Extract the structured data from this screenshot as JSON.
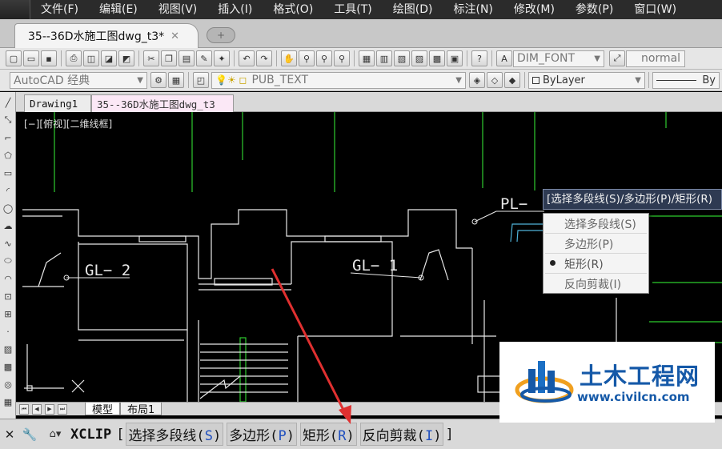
{
  "menubar": {
    "items": [
      "文件(F)",
      "编辑(E)",
      "视图(V)",
      "插入(I)",
      "格式(O)",
      "工具(T)",
      "绘图(D)",
      "标注(N)",
      "修改(M)",
      "参数(P)",
      "窗口(W)"
    ]
  },
  "tabbar": {
    "doc_tab_label": "35--36D水施工图dwg_t3*",
    "close_glyph": "✕"
  },
  "toolbar1": {
    "dim_style": "DIM_FONT",
    "text_style": "normal"
  },
  "toolbar2": {
    "workspace": "AutoCAD 经典",
    "layer": "PUB_TEXT",
    "color": "ByLayer",
    "linetype": "By"
  },
  "drawing_tabs": [
    "Drawing1",
    "35--36D水施工图dwg_t3"
  ],
  "viewport_label": "[−][俯视][二维线框]",
  "drawing_labels": {
    "gl2": "GL− 2",
    "gl1": "GL− 1",
    "pl": "PL−"
  },
  "layout_tabs": [
    "模型",
    "布局1"
  ],
  "prompt_tip": "[选择多段线(S)/多边形(P)/矩形(R)",
  "context_menu": {
    "items": [
      "选择多段线(S)",
      "多边形(P)",
      "矩形(R)",
      "反向剪裁(I)"
    ],
    "selected": "矩形(R)"
  },
  "cmdline": {
    "command": "XCLIP",
    "open_bracket": "[",
    "close_bracket": "]",
    "options": [
      {
        "text": "选择多段线(",
        "key": "S",
        "end": ")"
      },
      {
        "text": "多边形(",
        "key": "P",
        "end": ")"
      },
      {
        "text": "矩形(",
        "key": "R",
        "end": ")"
      },
      {
        "text": "反向剪裁(",
        "key": "I",
        "end": ")"
      }
    ]
  },
  "watermark": {
    "name": "土木工程网",
    "url": "www.civilcn.com"
  },
  "colors": {
    "canvas_bg": "#000000",
    "wall_lines": "#ffffff",
    "grid_lines": "#2ecc2e",
    "cyan_lines": "#4fb3d9",
    "annotation_arrow": "#e03030",
    "watermark_blue": "#1559a8"
  }
}
